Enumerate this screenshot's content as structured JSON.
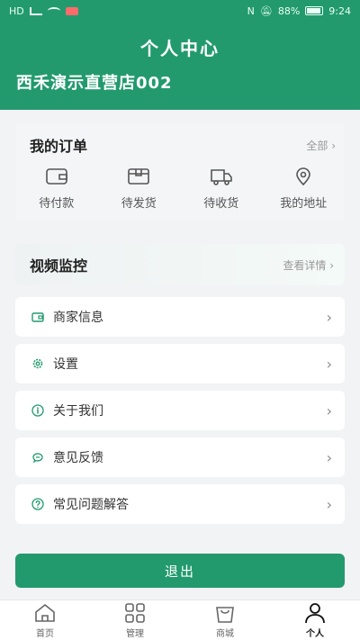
{
  "status_bar": {
    "left_text": "HD",
    "battery": "88%",
    "time": "9:24"
  },
  "header": {
    "title": "个人中心",
    "store_name": "西禾演示直营店002"
  },
  "orders": {
    "title": "我的订单",
    "all_label": "全部",
    "items": [
      {
        "label": "待付款",
        "icon": "wallet-icon"
      },
      {
        "label": "待发货",
        "icon": "package-icon"
      },
      {
        "label": "待收货",
        "icon": "truck-icon"
      },
      {
        "label": "我的地址",
        "icon": "location-icon"
      }
    ]
  },
  "video": {
    "title": "视频监控",
    "more_label": "查看详情"
  },
  "menu": [
    {
      "label": "商家信息",
      "icon": "merchant-card-icon"
    },
    {
      "label": "设置",
      "icon": "gear-icon"
    },
    {
      "label": "关于我们",
      "icon": "info-icon"
    },
    {
      "label": "意见反馈",
      "icon": "chat-bubble-icon"
    },
    {
      "label": "常见问题解答",
      "icon": "question-icon"
    }
  ],
  "logout_label": "退出",
  "tabs": [
    {
      "label": "首页",
      "icon": "home-icon",
      "active": false
    },
    {
      "label": "管理",
      "icon": "grid-icon",
      "active": false
    },
    {
      "label": "商城",
      "icon": "shopping-bag-icon",
      "active": false
    },
    {
      "label": "个人",
      "icon": "person-icon",
      "active": true
    }
  ],
  "colors": {
    "brand": "#229a6e",
    "background": "#f2f3f5"
  }
}
